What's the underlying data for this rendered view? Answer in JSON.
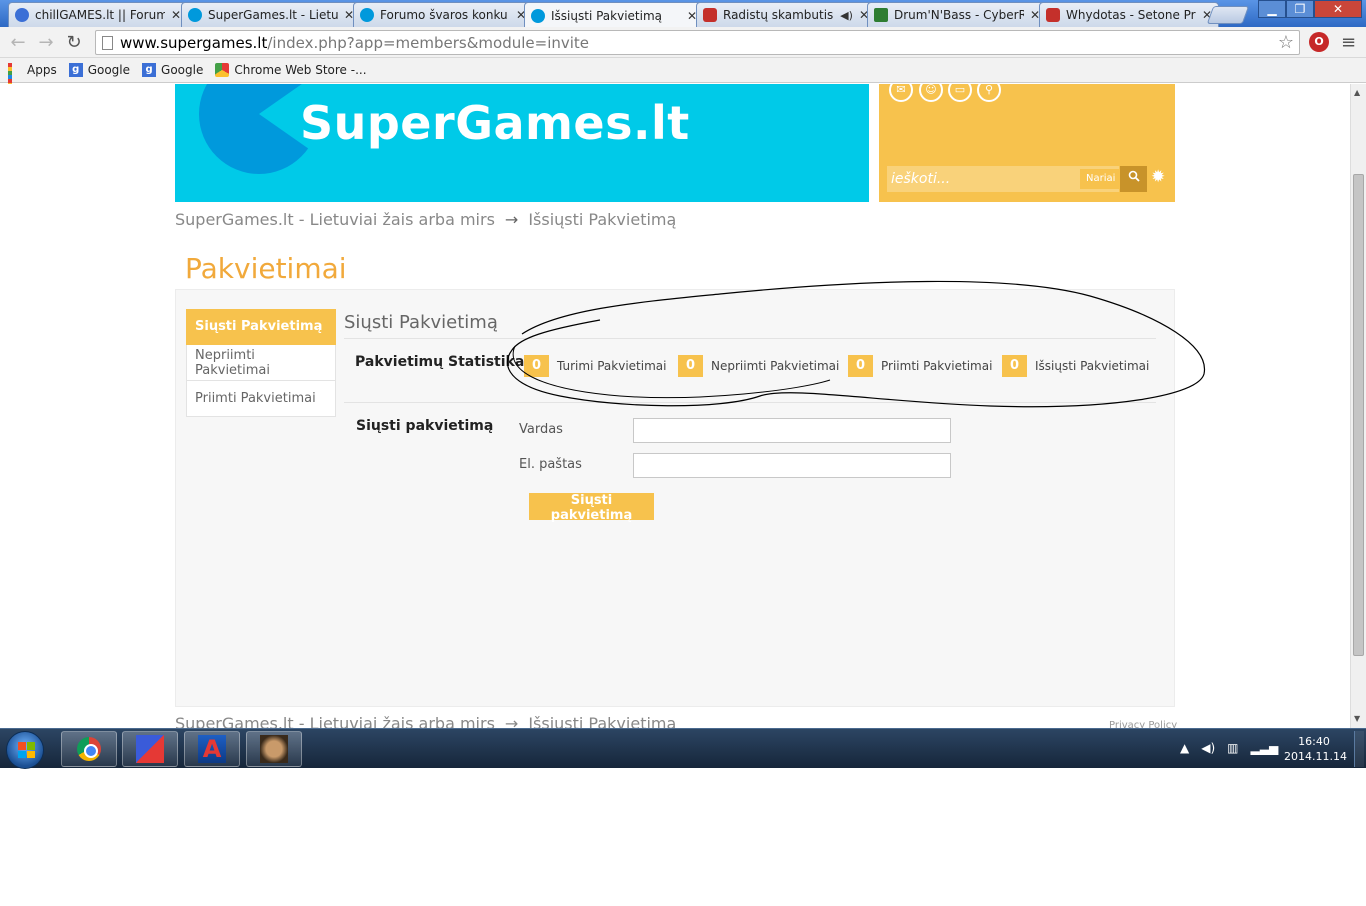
{
  "browser": {
    "tabs": [
      {
        "title": "chillGAMES.lt || Forum",
        "favicon_color": "#3b6fd6"
      },
      {
        "title": "SuperGames.lt - Lietuv",
        "favicon_color": "#0099dc"
      },
      {
        "title": "Forumo švaros konku",
        "favicon_color": "#0099dc"
      },
      {
        "title": "Išsiųsti Pakvietimą",
        "favicon_color": "#0099dc"
      },
      {
        "title": "Radistų skambutis",
        "favicon_color": "#c4302b"
      },
      {
        "title": "Drum'N'Bass - CyberR",
        "favicon_color": "#2e7d32"
      },
      {
        "title": "Whydotas - Setone Pr",
        "favicon_color": "#c4302b"
      }
    ],
    "url_host": "www.supergames.lt",
    "url_path": "/index.php?app=members&module=invite",
    "bookmarks": [
      "Apps",
      "Google",
      "Google",
      "Chrome Web Store -..."
    ]
  },
  "site": {
    "title": "SuperGames.lt",
    "search_placeholder": "ieškoti...",
    "search_scope": "Nariai",
    "colors": {
      "banner": "#00cae8",
      "accent": "#f7c24d",
      "title": "#f1a93b"
    }
  },
  "breadcrumb": {
    "home": "SuperGames.lt - Lietuviai žais arba mirs",
    "separator": "→",
    "current": "Išsiųsti Pakvietimą"
  },
  "page": {
    "title": "Pakvietimai",
    "sidenav": [
      "Siųsti Pakvietimą",
      "Nepriimti Pakvietimai",
      "Priimti Pakvietimai"
    ],
    "section_title": "Siųsti Pakvietimą",
    "stats_label": "Pakvietimų Statistika",
    "stats": [
      {
        "value": "0",
        "label": "Turimi Pakvietimai"
      },
      {
        "value": "0",
        "label": "Nepriimti Pakvietimai"
      },
      {
        "value": "0",
        "label": "Priimti Pakvietimai"
      },
      {
        "value": "0",
        "label": "Išsiųsti Pakvietimai"
      }
    ],
    "form_title": "Siųsti pakvietimą",
    "fields": [
      {
        "label": "Vardas",
        "value": ""
      },
      {
        "label": "El. paštas",
        "value": ""
      }
    ],
    "submit_label": "Siųsti pakvietimą",
    "privacy": "Privacy Policy"
  },
  "taskbar": {
    "time": "16:40",
    "date": "2014.11.14"
  }
}
